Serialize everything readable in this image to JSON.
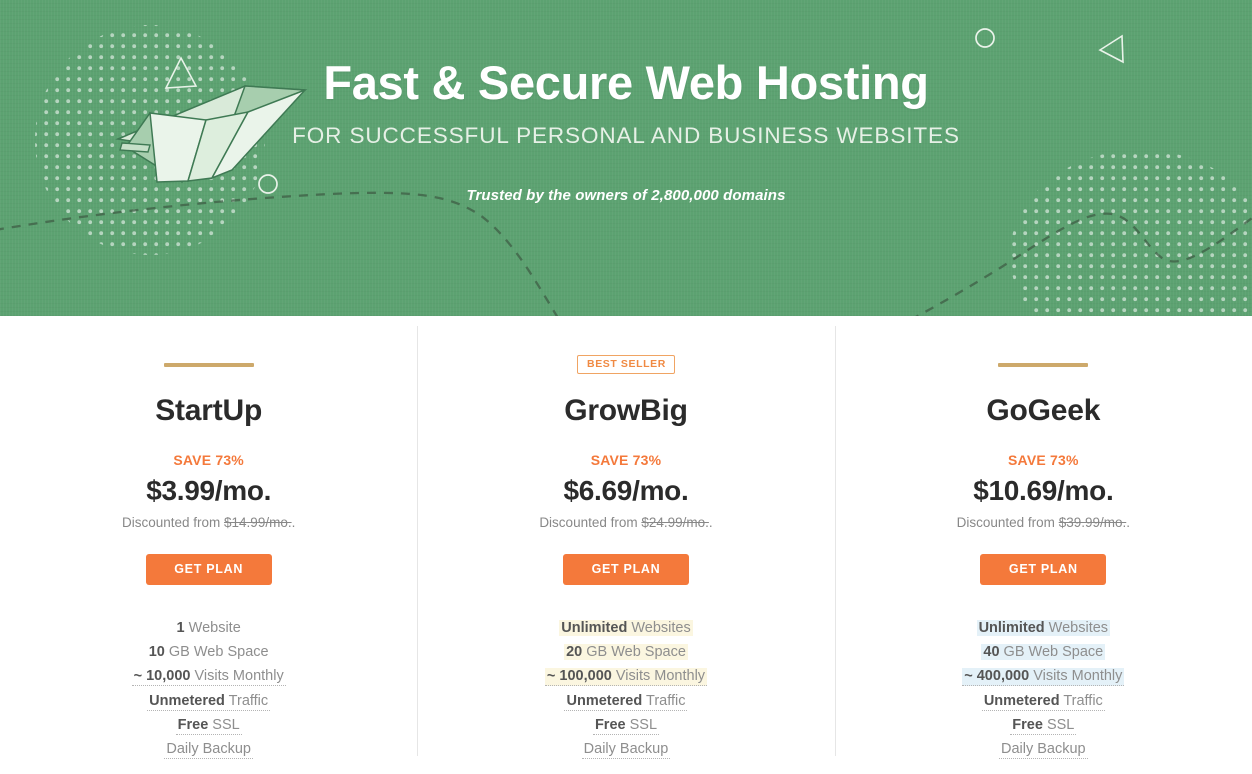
{
  "hero": {
    "title": "Fast & Secure Web Hosting",
    "subtitle": "FOR SUCCESSFUL PERSONAL AND BUSINESS WEBSITES",
    "trusted": "Trusted by the owners of 2,800,000 domains",
    "background_color": "#5ca271",
    "decor": {
      "airplane": "paper-airplane-origami",
      "triangle_left": "triangle-outline",
      "triangle_right": "triangle-outline-left-pointing",
      "circle_left": "circle-outline",
      "circle_right": "circle-outline",
      "dashed_wave": "dashed-wave-line",
      "dot_grid_left": "dot-grid",
      "dot_grid_right": "dot-grid"
    }
  },
  "accent_colors": {
    "orange": "#f4793b",
    "gold": "#cda96b",
    "badge_border": "#f0a463",
    "highlight_cream": "#fbf6e0",
    "highlight_blue": "#e4f1f8"
  },
  "plans": [
    {
      "name": "StartUp",
      "badge": null,
      "save": "SAVE 73%",
      "price": "$3.99/mo.",
      "discount_prefix": "Discounted from ",
      "discount_old": "$14.99/mo.",
      "discount_suffix": ".",
      "cta": "GET PLAN",
      "features": [
        {
          "strong": "1",
          "rest": " Website",
          "highlight": "none",
          "dotted": false
        },
        {
          "strong": "10",
          "rest": " GB Web Space",
          "highlight": "none",
          "dotted": false
        },
        {
          "strong": "~ 10,000",
          "rest": " Visits Monthly",
          "highlight": "none",
          "dotted": true
        },
        {
          "strong": "Unmetered",
          "rest": " Traffic",
          "highlight": "none",
          "dotted": true
        },
        {
          "strong": "Free",
          "rest": " SSL",
          "highlight": "none",
          "dotted": true
        },
        {
          "strong": "",
          "rest": "Daily Backup",
          "highlight": "none",
          "dotted": true
        }
      ]
    },
    {
      "name": "GrowBig",
      "badge": "BEST SELLER",
      "save": "SAVE 73%",
      "price": "$6.69/mo.",
      "discount_prefix": "Discounted from ",
      "discount_old": "$24.99/mo.",
      "discount_suffix": ".",
      "cta": "GET PLAN",
      "features": [
        {
          "strong": "Unlimited",
          "rest": " Websites",
          "highlight": "cream",
          "dotted": false
        },
        {
          "strong": "20",
          "rest": " GB Web Space",
          "highlight": "cream",
          "dotted": false
        },
        {
          "strong": "~ 100,000",
          "rest": " Visits Monthly",
          "highlight": "cream",
          "dotted": true
        },
        {
          "strong": "Unmetered",
          "rest": " Traffic",
          "highlight": "none",
          "dotted": true
        },
        {
          "strong": "Free",
          "rest": " SSL",
          "highlight": "none",
          "dotted": true
        },
        {
          "strong": "",
          "rest": "Daily Backup",
          "highlight": "none",
          "dotted": true
        }
      ]
    },
    {
      "name": "GoGeek",
      "badge": null,
      "save": "SAVE 73%",
      "price": "$10.69/mo.",
      "discount_prefix": "Discounted from ",
      "discount_old": "$39.99/mo.",
      "discount_suffix": ".",
      "cta": "GET PLAN",
      "features": [
        {
          "strong": "Unlimited",
          "rest": " Websites",
          "highlight": "blue",
          "dotted": false
        },
        {
          "strong": "40",
          "rest": " GB Web Space",
          "highlight": "blue",
          "dotted": false
        },
        {
          "strong": "~ 400,000",
          "rest": " Visits Monthly",
          "highlight": "blue",
          "dotted": true
        },
        {
          "strong": "Unmetered",
          "rest": " Traffic",
          "highlight": "none",
          "dotted": true
        },
        {
          "strong": "Free",
          "rest": " SSL",
          "highlight": "none",
          "dotted": true
        },
        {
          "strong": "",
          "rest": "Daily Backup",
          "highlight": "none",
          "dotted": true
        }
      ]
    }
  ]
}
